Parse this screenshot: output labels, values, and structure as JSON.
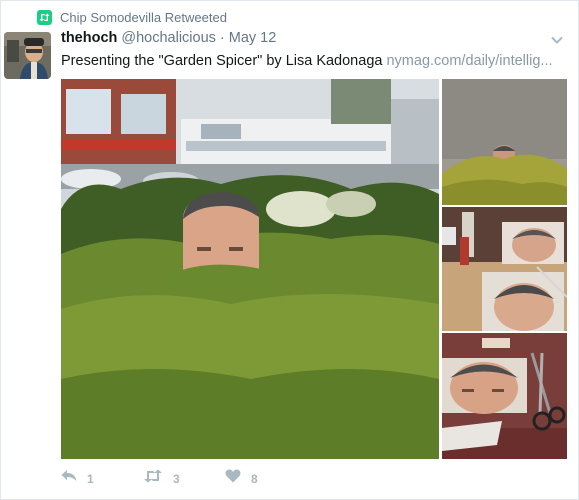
{
  "context": {
    "text": "Chip Somodevilla Retweeted",
    "icon": "retweet-icon",
    "icon_color": "#19cf86"
  },
  "author": {
    "name": "thehoch",
    "handle": "@hochalicious",
    "separator": "·",
    "date": "May 12"
  },
  "tweet": {
    "text": "Presenting the \"Garden Spicer\" by Lisa Kadonaga ",
    "link_text": "nymag.com/daily/intellig..."
  },
  "media": {
    "photo_count": 4
  },
  "actions": {
    "reply": {
      "icon": "reply-icon",
      "count": "1"
    },
    "retweet": {
      "icon": "retweet-icon",
      "count": "3"
    },
    "like": {
      "icon": "heart-icon",
      "count": "8"
    }
  },
  "colors": {
    "muted": "#657786",
    "link": "#8899a6",
    "action": "#aab8c2",
    "border": "#e1e8ed"
  }
}
